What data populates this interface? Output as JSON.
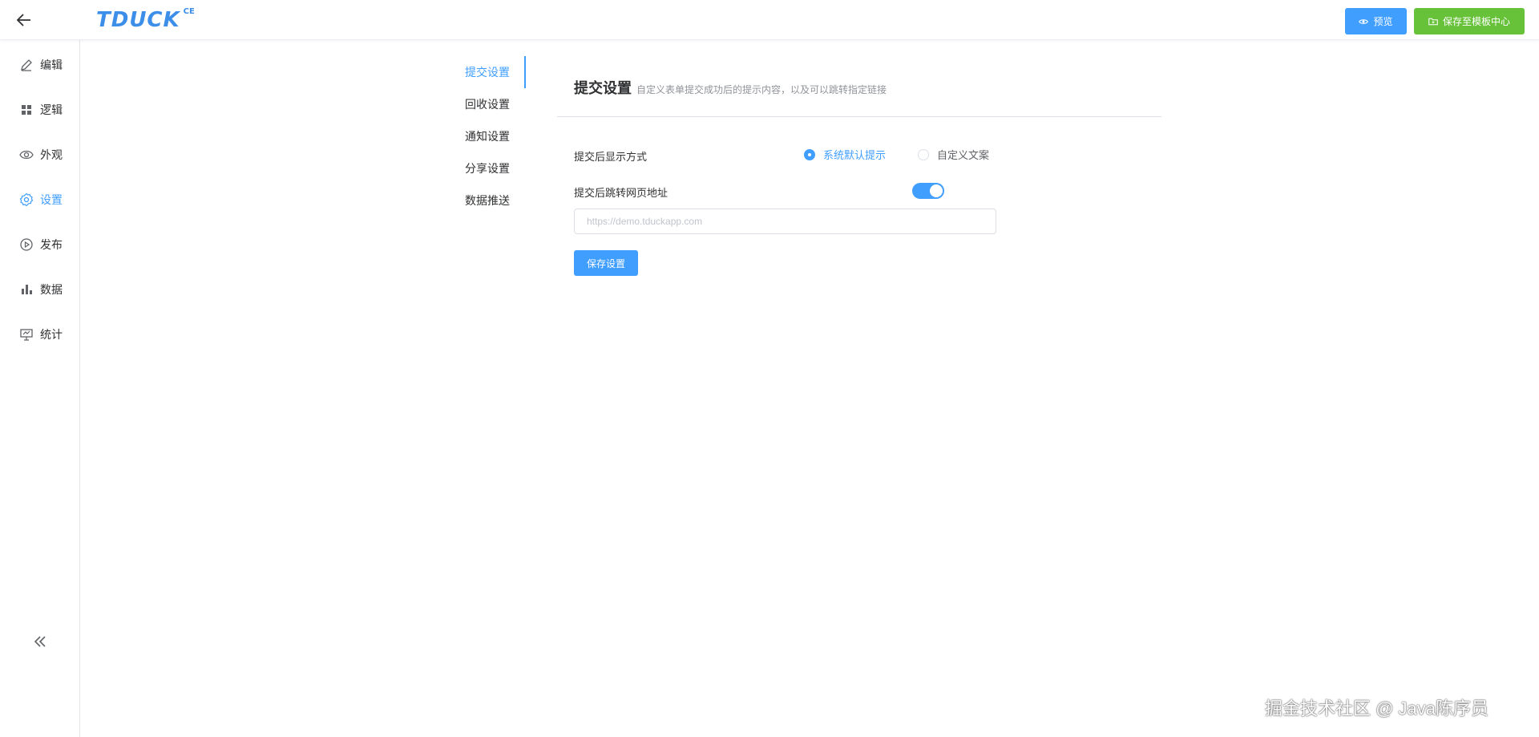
{
  "header": {
    "logo_text": "TDUCK",
    "logo_sup": "CE",
    "preview_label": "预览",
    "save_template_label": "保存至模板中心"
  },
  "sidebar": {
    "items": [
      {
        "label": "编辑",
        "icon": "edit-icon"
      },
      {
        "label": "逻辑",
        "icon": "grid-icon"
      },
      {
        "label": "外观",
        "icon": "eye-icon"
      },
      {
        "label": "设置",
        "icon": "gear-icon"
      },
      {
        "label": "发布",
        "icon": "play-icon"
      },
      {
        "label": "数据",
        "icon": "bar-chart-icon"
      },
      {
        "label": "统计",
        "icon": "presentation-icon"
      }
    ],
    "active_index": 3
  },
  "submenu": {
    "items": [
      {
        "label": "提交设置"
      },
      {
        "label": "回收设置"
      },
      {
        "label": "通知设置"
      },
      {
        "label": "分享设置"
      },
      {
        "label": "数据推送"
      }
    ],
    "active_index": 0
  },
  "panel": {
    "title": "提交设置",
    "description": "自定义表单提交成功后的提示内容，以及可以跳转指定链接",
    "display_mode_label": "提交后显示方式",
    "radio_default_label": "系统默认提示",
    "radio_custom_label": "自定义文案",
    "selected_option": "系统默认提示",
    "redirect_label": "提交后跳转网页地址",
    "redirect_enabled": true,
    "url_placeholder": "https://demo.tduckapp.com",
    "url_value": "",
    "save_label": "保存设置"
  },
  "watermark": "掘金技术社区 @ Java陈序员",
  "colors": {
    "primary": "#409eff",
    "success": "#67c23a",
    "logo": "#3d8ee8"
  }
}
